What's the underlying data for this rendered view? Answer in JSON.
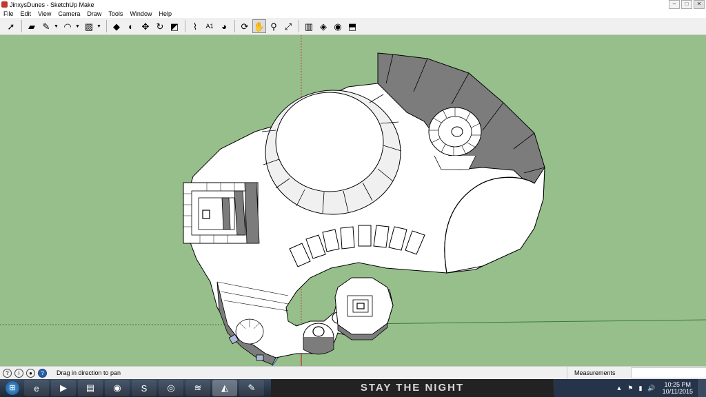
{
  "window": {
    "title": "JinxysDunes - SketchUp Make",
    "min": "–",
    "max": "□",
    "close": "✕"
  },
  "menu": [
    "File",
    "Edit",
    "View",
    "Camera",
    "Draw",
    "Tools",
    "Window",
    "Help"
  ],
  "toolbar": {
    "tools": [
      {
        "name": "select-tool",
        "glyph": "➚"
      },
      {
        "name": "sep"
      },
      {
        "name": "eraser-tool",
        "glyph": "▰"
      },
      {
        "name": "pencil-tool",
        "glyph": "✎",
        "dropdown": true
      },
      {
        "name": "arc-tool",
        "glyph": "◠",
        "dropdown": true
      },
      {
        "name": "rectangle-tool",
        "glyph": "▨",
        "dropdown": true
      },
      {
        "name": "sep"
      },
      {
        "name": "push-pull-tool",
        "glyph": "◆"
      },
      {
        "name": "follow-me-tool",
        "glyph": "◐"
      },
      {
        "name": "move-tool",
        "glyph": "✥"
      },
      {
        "name": "rotate-tool",
        "glyph": "↻"
      },
      {
        "name": "scale-tool",
        "glyph": "◩"
      },
      {
        "name": "sep"
      },
      {
        "name": "tape-measure-tool",
        "glyph": "⌇"
      },
      {
        "name": "text-tool",
        "glyph": "A1"
      },
      {
        "name": "paint-bucket-tool",
        "glyph": "◕"
      },
      {
        "name": "sep"
      },
      {
        "name": "orbit-tool",
        "glyph": "⟳"
      },
      {
        "name": "pan-tool",
        "glyph": "✋",
        "active": true
      },
      {
        "name": "zoom-tool",
        "glyph": "⚲"
      },
      {
        "name": "zoom-extents-tool",
        "glyph": "⤢"
      },
      {
        "name": "sep"
      },
      {
        "name": "warehouse-tool",
        "glyph": "▥"
      },
      {
        "name": "components-tool",
        "glyph": "◈"
      },
      {
        "name": "extension-tool",
        "glyph": "◉"
      },
      {
        "name": "share-model-tool",
        "glyph": "⬒"
      }
    ]
  },
  "status": {
    "message": "Drag in direction to pan",
    "measurements_label": "Measurements",
    "measurements_value": ""
  },
  "taskbar": {
    "banner": "STAY THE NIGHT",
    "apps": [
      {
        "name": "internet-explorer-icon",
        "glyph": "e"
      },
      {
        "name": "media-player-icon",
        "glyph": "▶"
      },
      {
        "name": "file-explorer-icon",
        "glyph": "▤"
      },
      {
        "name": "chrome-icon",
        "glyph": "◉"
      },
      {
        "name": "skype-icon",
        "glyph": "S"
      },
      {
        "name": "camera-app-icon",
        "glyph": "◎"
      },
      {
        "name": "spotify-icon",
        "glyph": "≋"
      },
      {
        "name": "sketchup-icon",
        "glyph": "◭",
        "active": true
      },
      {
        "name": "paint-icon",
        "glyph": "✎"
      }
    ],
    "tray_icons": [
      "▲",
      "⚑",
      "▮",
      "🔊"
    ],
    "clock_time": "10:25 PM",
    "clock_date": "10/11/2015"
  },
  "colors": {
    "ground": "#96bf8b",
    "shadow": "#7c7c7c",
    "face": "#ffffff",
    "edge": "#000000"
  }
}
